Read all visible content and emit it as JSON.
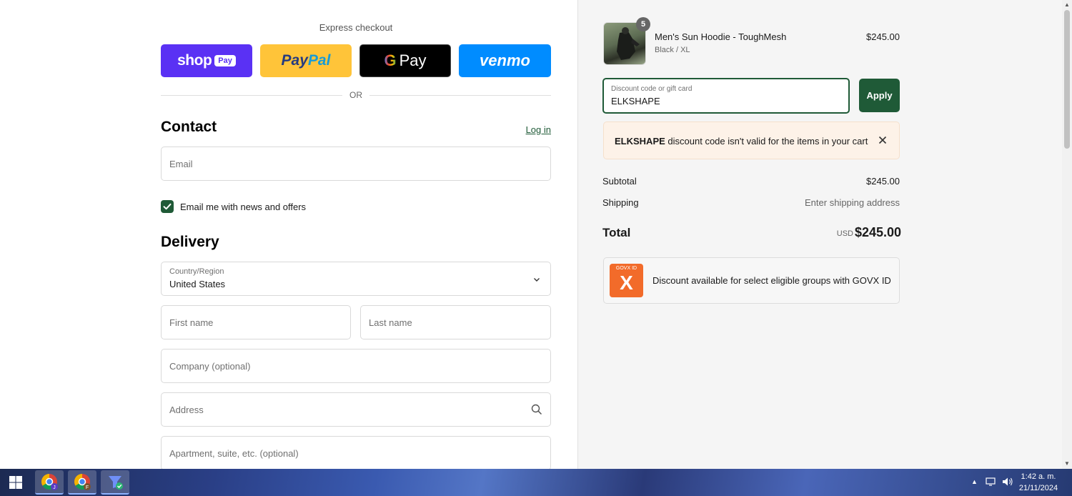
{
  "express": {
    "title": "Express checkout",
    "shop_pay": {
      "label": "shop",
      "badge": "Pay"
    },
    "paypal": {
      "pay": "Pay",
      "pal": "Pal"
    },
    "gpay": {
      "g": "G",
      "label": "Pay"
    },
    "venmo": "venmo",
    "or": "OR"
  },
  "contact": {
    "title": "Contact",
    "login": "Log in",
    "email_placeholder": "Email",
    "news_label": "Email me with news and offers",
    "news_checked": true
  },
  "delivery": {
    "title": "Delivery",
    "country_label": "Country/Region",
    "country_value": "United States",
    "first_name": "First name",
    "last_name": "Last name",
    "company": "Company (optional)",
    "address": "Address",
    "apartment": "Apartment, suite, etc. (optional)"
  },
  "summary": {
    "item": {
      "quantity": "5",
      "name": "Men's Sun Hoodie - ToughMesh",
      "variant": "Black / XL",
      "price": "$245.00"
    },
    "discount": {
      "label": "Discount code or gift card",
      "value": "ELKSHAPE",
      "apply": "Apply"
    },
    "error": {
      "code": "ELKSHAPE",
      "message": " discount code isn't valid for the items in your cart"
    },
    "subtotal_label": "Subtotal",
    "subtotal": "$245.00",
    "shipping_label": "Shipping",
    "shipping": "Enter shipping address",
    "total_label": "Total",
    "currency": "USD",
    "total": "$245.00",
    "govx": {
      "logo_text": "GOVX ID",
      "logo_mark": "X",
      "text": "Discount available for select eligible groups with GOVX ID"
    }
  },
  "taskbar": {
    "time": "1:42 a. m.",
    "date": "21/11/2024",
    "apps": [
      {
        "name": "chrome-profile-j",
        "badge": "J"
      },
      {
        "name": "chrome-profile-f",
        "badge": "F"
      },
      {
        "name": "app-check"
      }
    ]
  },
  "colors": {
    "accent": "#1f5a37",
    "shop_pay": "#5a31f4",
    "paypal": "#ffc439",
    "venmo": "#008cff",
    "error_bg": "#fdf2e8",
    "govx": "#f26b2a"
  }
}
